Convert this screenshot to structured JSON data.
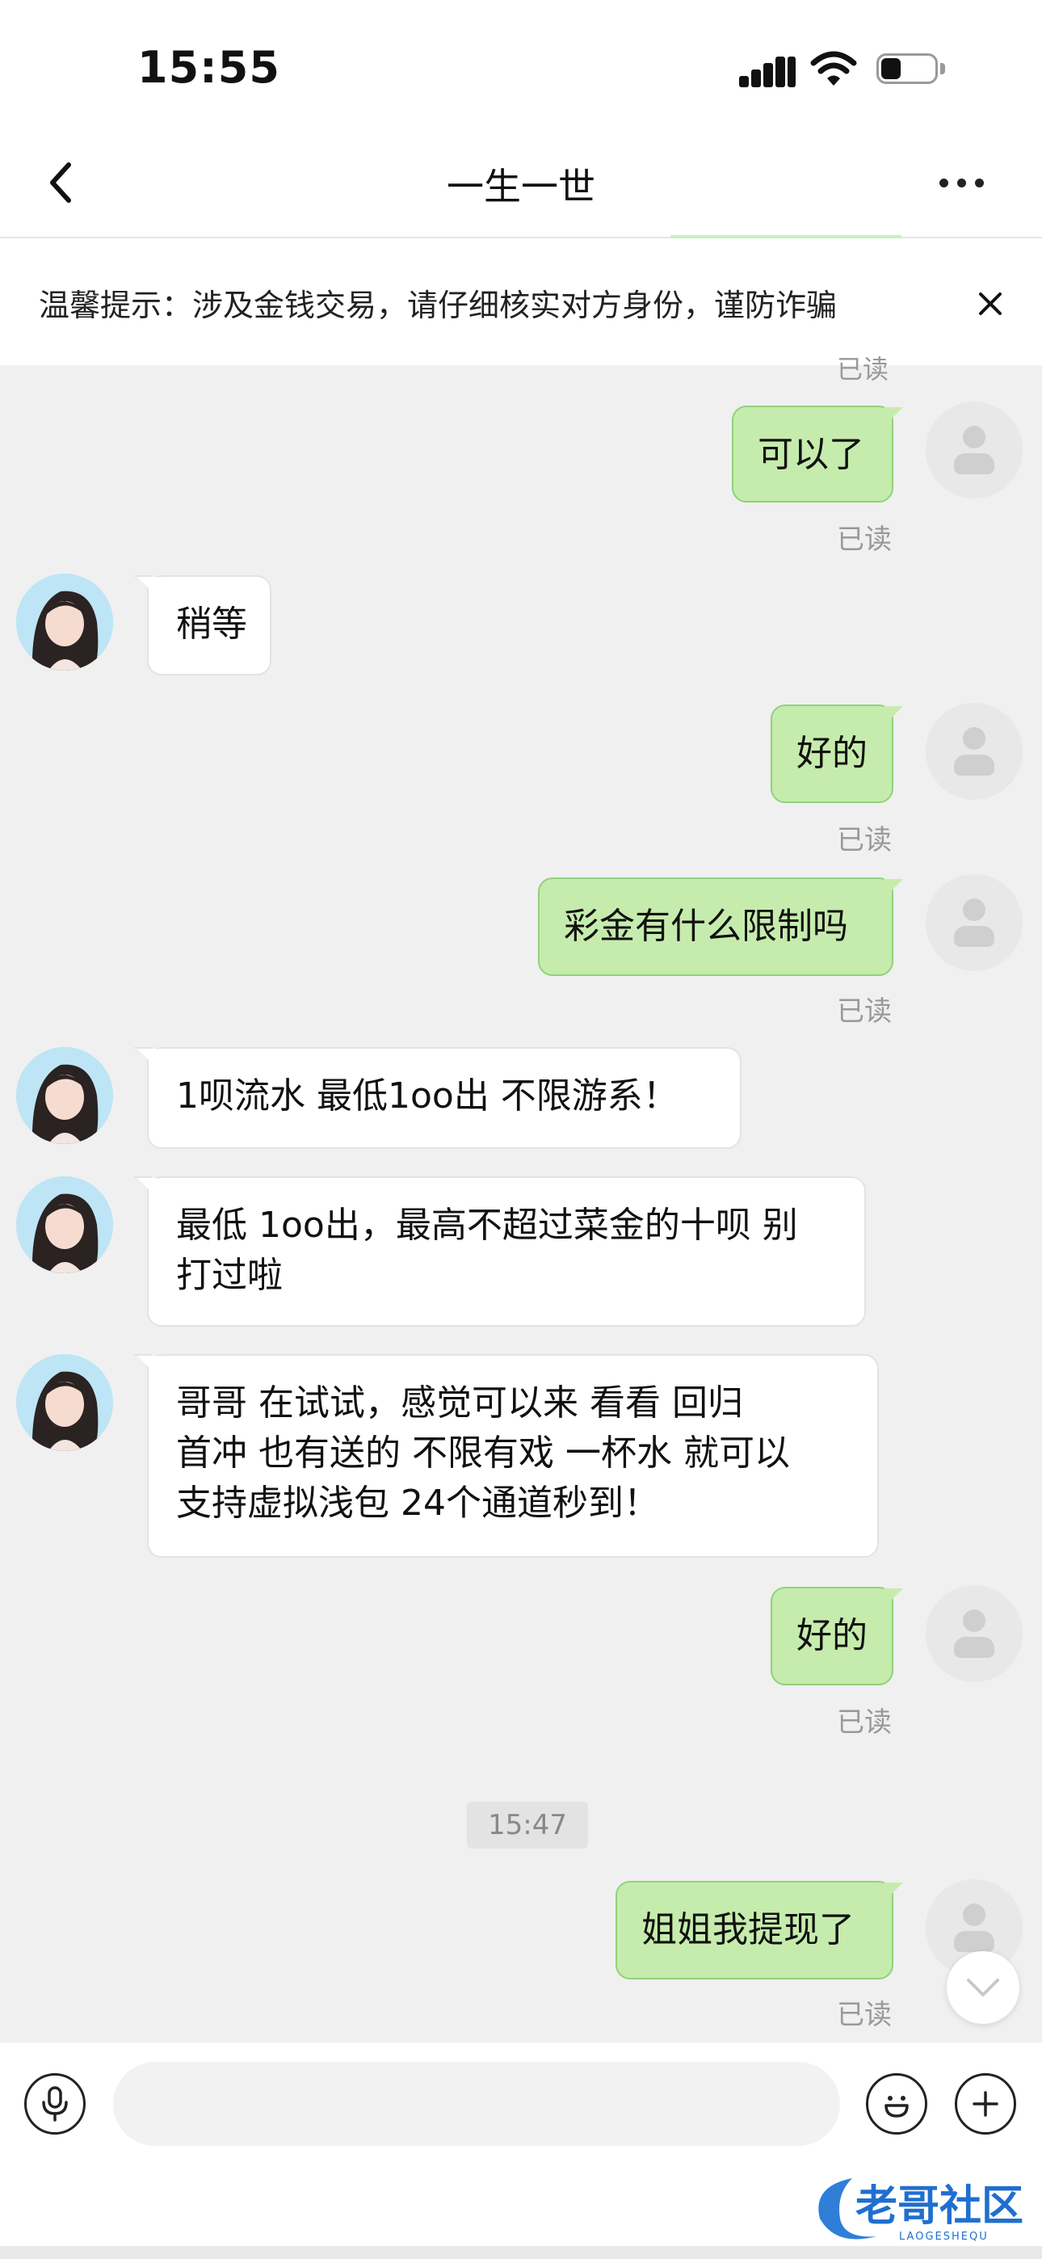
{
  "status_bar": {
    "time": "15:55"
  },
  "nav": {
    "title": "一生一世"
  },
  "warning": {
    "text": "温馨提示：涉及金钱交易，请仔细核实对方身份，谨防诈骗"
  },
  "messages": [
    {
      "id": "m1",
      "side": "out",
      "text": "可以了",
      "read": "已读"
    },
    {
      "id": "m2",
      "side": "in",
      "text": "稍等"
    },
    {
      "id": "m3",
      "side": "out",
      "text": "好的",
      "read": "已读"
    },
    {
      "id": "m4",
      "side": "out",
      "text": "彩金有什么限制吗",
      "read": "已读"
    },
    {
      "id": "m5",
      "side": "in",
      "text": "1呗流水 最低1oo出  不限游系！"
    },
    {
      "id": "m6",
      "side": "in",
      "lines": [
        "最低 1oo出，最高不超过菜金的十呗 别",
        "打过啦"
      ]
    },
    {
      "id": "m7",
      "side": "in",
      "lines": [
        "哥哥  在试试，感觉可以来   看看  回归",
        "首冲 也有送的 不限有戏  一杯水 就可以",
        "支持虚拟浅包 24个通道秒到！"
      ]
    },
    {
      "id": "m8",
      "side": "out",
      "text": "好的",
      "read": "已读"
    },
    {
      "id": "m9",
      "side": "out",
      "text": "姐姐我提现了",
      "read": "已读"
    }
  ],
  "read_label_top_partial": "已读",
  "time_divider": "15:47",
  "input": {
    "placeholder": ""
  },
  "watermark": {
    "text": "老哥社区",
    "subtext": "LAOGESHEQU"
  },
  "icons": {
    "back": "back-chevron-icon",
    "more": "more-dots-icon",
    "close": "close-icon",
    "voice": "microphone-icon",
    "emoji": "emoji-icon",
    "add": "plus-icon",
    "scroll_down": "chevron-down-icon"
  },
  "colors": {
    "outgoing_bubble": "#c6ecad",
    "incoming_bubble": "#ffffff",
    "chat_background": "#f0f0f0",
    "read_label": "#999999"
  }
}
